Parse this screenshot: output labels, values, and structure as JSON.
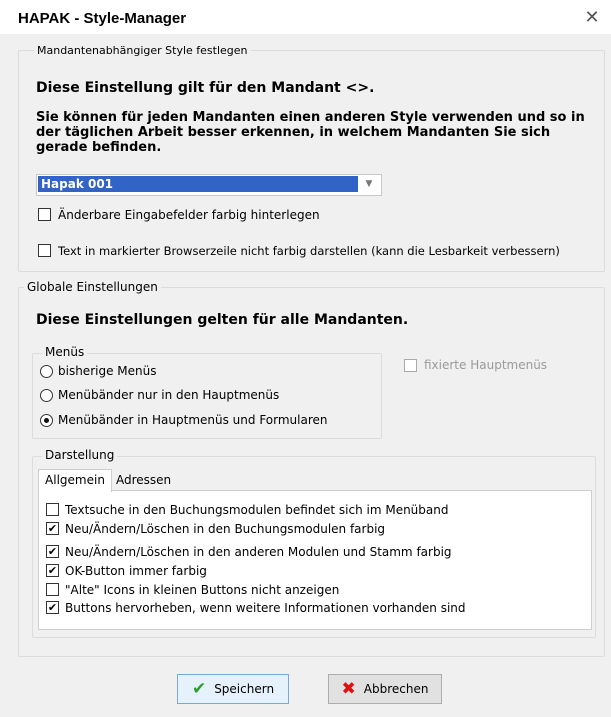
{
  "window": {
    "title": "HAPAK - Style-Manager",
    "close_icon": "close-icon"
  },
  "mandant_group": {
    "legend": "Mandantenabhängiger Style festlegen",
    "heading": "Diese Einstellung gilt für den Mandant <>.",
    "description": "Sie können für jeden Mandanten einen anderen Style verwenden und so in der täglichen Arbeit besser erkennen, in welchem Mandanten Sie sich gerade befinden.",
    "style_select": {
      "value": "Hapak 001"
    },
    "checkbox_fields_colored": {
      "label": "Änderbare Eingabefelder farbig hinterlegen",
      "checked": false
    },
    "checkbox_browser_row": {
      "label": "Text in markierter Browserzeile nicht farbig darstellen (kann die Lesbarkeit verbessern)",
      "checked": false
    }
  },
  "global_group": {
    "legend": "Globale Einstellungen",
    "heading": "Diese Einstellungen gelten für alle Mandanten.",
    "menus": {
      "legend": "Menüs",
      "options": [
        {
          "label": "bisherige Menüs",
          "selected": false
        },
        {
          "label": "Menübänder nur in den Hauptmenüs",
          "selected": false
        },
        {
          "label": "Menübänder in Hauptmenüs und Formularen",
          "selected": true
        }
      ]
    },
    "fixed_main_menus": {
      "label": "fixierte Hauptmenüs",
      "checked": false,
      "enabled": false
    },
    "display": {
      "legend": "Darstellung",
      "tabs": [
        {
          "label": "Allgemein",
          "active": true
        },
        {
          "label": "Adressen",
          "active": false
        }
      ],
      "options": [
        {
          "label": "Textsuche in den Buchungsmodulen befindet sich im Menüband",
          "checked": false
        },
        {
          "label": "Neu/Ändern/Löschen in den Buchungsmodulen farbig",
          "checked": true
        },
        {
          "label": "Neu/Ändern/Löschen in den anderen Modulen und Stamm farbig",
          "checked": true
        },
        {
          "label": "OK-Button immer farbig",
          "checked": true
        },
        {
          "label": "\"Alte\" Icons in kleinen Buttons nicht anzeigen",
          "checked": false
        },
        {
          "label": "Buttons hervorheben, wenn weitere Informationen vorhanden sind",
          "checked": true
        }
      ]
    }
  },
  "buttons": {
    "save": {
      "label": "Speichern",
      "icon": "checkmark-icon"
    },
    "cancel": {
      "label": "Abbrechen",
      "icon": "cross-icon"
    }
  }
}
